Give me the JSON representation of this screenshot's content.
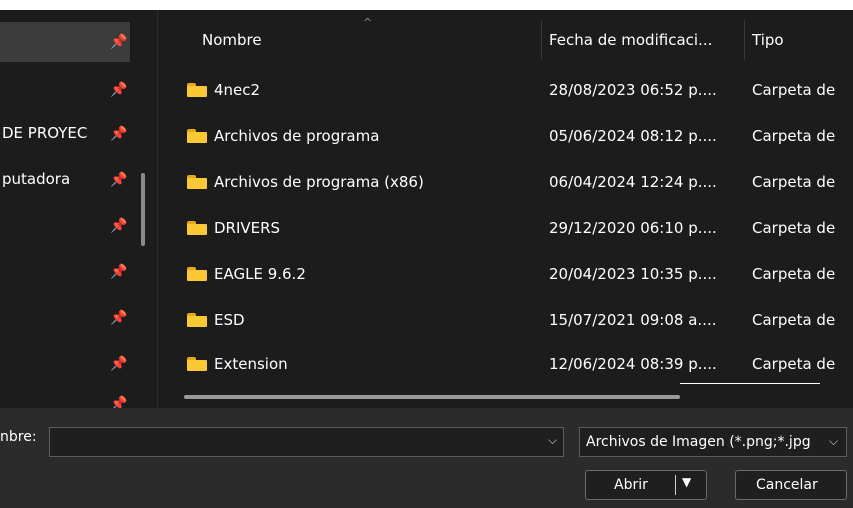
{
  "sidebar": {
    "items": [
      {
        "label": "",
        "pinned": true
      },
      {
        "label": "",
        "pinned": true
      },
      {
        "label": "DE PROYEC",
        "pinned": true
      },
      {
        "label": "putadora",
        "pinned": true
      },
      {
        "label": "",
        "pinned": true
      },
      {
        "label": "",
        "pinned": true
      },
      {
        "label": "",
        "pinned": true
      },
      {
        "label": "",
        "pinned": true
      },
      {
        "label": "",
        "pinned": true
      }
    ],
    "pin_glyph": "📌"
  },
  "file_list": {
    "columns": {
      "name": "Nombre",
      "date": "Fecha de modificaci...",
      "type": "Tipo"
    },
    "sort_indicator": "^",
    "rows": [
      {
        "name": "4nec2",
        "date": "28/08/2023 06:52 p....",
        "type": "Carpeta de"
      },
      {
        "name": "Archivos de programa",
        "date": "05/06/2024 08:12 p....",
        "type": "Carpeta de"
      },
      {
        "name": "Archivos de programa (x86)",
        "date": "06/04/2024 12:24 p....",
        "type": "Carpeta de"
      },
      {
        "name": "DRIVERS",
        "date": "29/12/2020 06:10 p....",
        "type": "Carpeta de"
      },
      {
        "name": "EAGLE 9.6.2",
        "date": "20/04/2023 10:35 p....",
        "type": "Carpeta de"
      },
      {
        "name": "ESD",
        "date": "15/07/2021 09:08 a....",
        "type": "Carpeta de"
      },
      {
        "name": "Extension",
        "date": "12/06/2024 08:39 p....",
        "type": "Carpeta de"
      }
    ]
  },
  "bottom": {
    "filename_label": "nbre:",
    "filename_value": "",
    "filter_value": "Archivos de Imagen (*.png;*.jpg",
    "open_label": "Abrir",
    "cancel_label": "Cancelar"
  },
  "colors": {
    "folder": "#f9c833",
    "background": "#1c1c1c",
    "panel": "#2b2b2b"
  }
}
